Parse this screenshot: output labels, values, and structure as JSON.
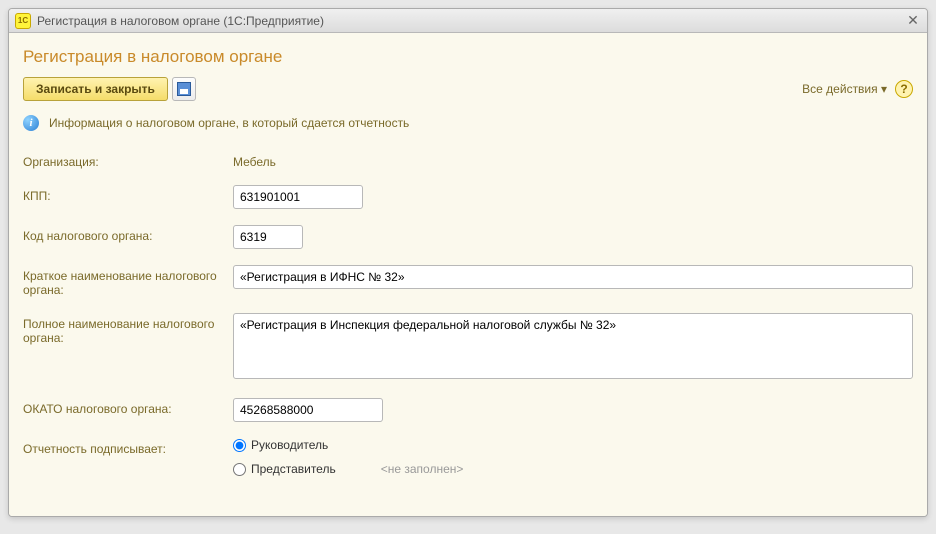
{
  "window": {
    "title": "Регистрация в налоговом органе  (1С:Предприятие)",
    "app_icon_text": "1С"
  },
  "form": {
    "title": "Регистрация в налоговом органе"
  },
  "toolbar": {
    "save_close_label": "Записать и закрыть",
    "all_actions_label": "Все действия ▾",
    "help_label": "?"
  },
  "info": {
    "text": "Информация о налоговом органе, в который сдается отчетность"
  },
  "fields": {
    "organization": {
      "label": "Организация:",
      "value": "Мебель"
    },
    "kpp": {
      "label": "КПП:",
      "value": "631901001"
    },
    "tax_code": {
      "label": "Код налогового органа:",
      "value": "6319"
    },
    "short_name": {
      "label": "Краткое наименование налогового органа:",
      "value": "«Регистрация в ИФНС № 32»"
    },
    "full_name": {
      "label": "Полное наименование налогового органа:",
      "value": "«Регистрация в Инспекция федеральной налоговой службы № 32»"
    },
    "okato": {
      "label": "ОКАТО налогового органа:",
      "value": "45268588000"
    },
    "signer": {
      "label": "Отчетность подписывает:",
      "option_head": "Руководитель",
      "option_rep": "Представитель",
      "rep_placeholder": "<не заполнен>"
    }
  }
}
